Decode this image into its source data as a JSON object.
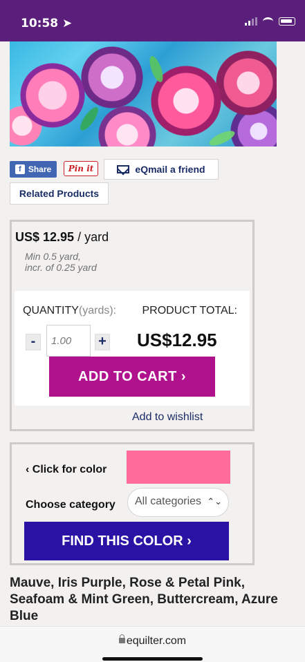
{
  "status_bar": {
    "time": "10:58",
    "location_icon": "arrow-icon"
  },
  "share": {
    "facebook": "Share",
    "pinterest": "Pin it",
    "email": "eQmail a friend",
    "related": "Related Products"
  },
  "pricing": {
    "price_bold": "US$ 12.95",
    "price_unit": "/ yard",
    "min_line1": "Min 0.5 yard,",
    "min_line2": "incr. of 0.25 yard",
    "quantity_label": "QUANTITY",
    "quantity_unit": "(yards):",
    "product_total_label": "PRODUCT TOTAL:",
    "quantity_value": "1.00",
    "minus": "-",
    "plus": "+",
    "total_value": "US$12.95",
    "add_to_cart": "ADD TO CART",
    "wishlist": "Add to wishlist"
  },
  "color_finder": {
    "click_for_color": "Click for color",
    "choose_category": "Choose category",
    "category_selected": "All categories",
    "find_color": "FIND THIS COLOR",
    "swatch_color": "#ff6b9b"
  },
  "description": "Mauve, Iris Purple, Rose & Petal Pink, Seafoam & Mint Green, Buttercream, Azure Blue",
  "url": "equilter.com",
  "colors": {
    "status_bar": "#5a1f7a",
    "add_to_cart": "#b0128e",
    "find_color": "#2a12a4",
    "link": "#1a2c66"
  }
}
